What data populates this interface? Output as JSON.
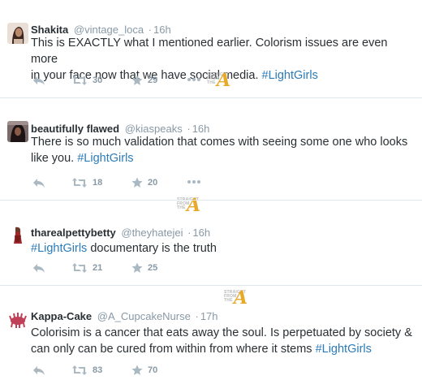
{
  "tweets": [
    {
      "name": "Shakita",
      "handle": "@vintage_loca",
      "time": "16h",
      "text_line1": "This is EXACTLY what I mentioned earlier. Colorism issues are even more",
      "text_line2_prefix": "in your face now that we have social media. ",
      "hashtag": "#LightGirls",
      "retweets": "30",
      "favorites": "29"
    },
    {
      "name": "beautifully flawed",
      "handle": "@kiaspeaks",
      "time": "16h",
      "text_line1": "There is so much validation that comes with seeing some one who looks",
      "text_line2_prefix": "like you. ",
      "hashtag": "#LightGirls",
      "retweets": "18",
      "favorites": "20"
    },
    {
      "name": "tharealpettybetty",
      "handle": "@theyhatejei",
      "time": "16h",
      "hashtag": "#LightGirls",
      "text_suffix": " documentary is the truth",
      "retweets": "21",
      "favorites": "25"
    },
    {
      "name": "Kappa-Cake",
      "handle": "@A_CupcakeNurse",
      "time": "17h",
      "text_line1": "Colorisim is a cancer that eats away the soul. Is perpetuated by society &",
      "text_line2_prefix": "can only can be cured from within from where it stems ",
      "hashtag": "#LightGirls",
      "retweets": "83",
      "favorites": "70"
    }
  ],
  "dot": "·",
  "watermark": {
    "line1": "STRAIGHT",
    "line2": "FROM",
    "line3": "THE",
    "letter": "A"
  },
  "colors": {
    "hashtag": "#2b7bb9",
    "meta": "#8899a6",
    "text": "#292f33",
    "divider": "#e1e8ed",
    "watermark_accent": "#e8a82a"
  }
}
